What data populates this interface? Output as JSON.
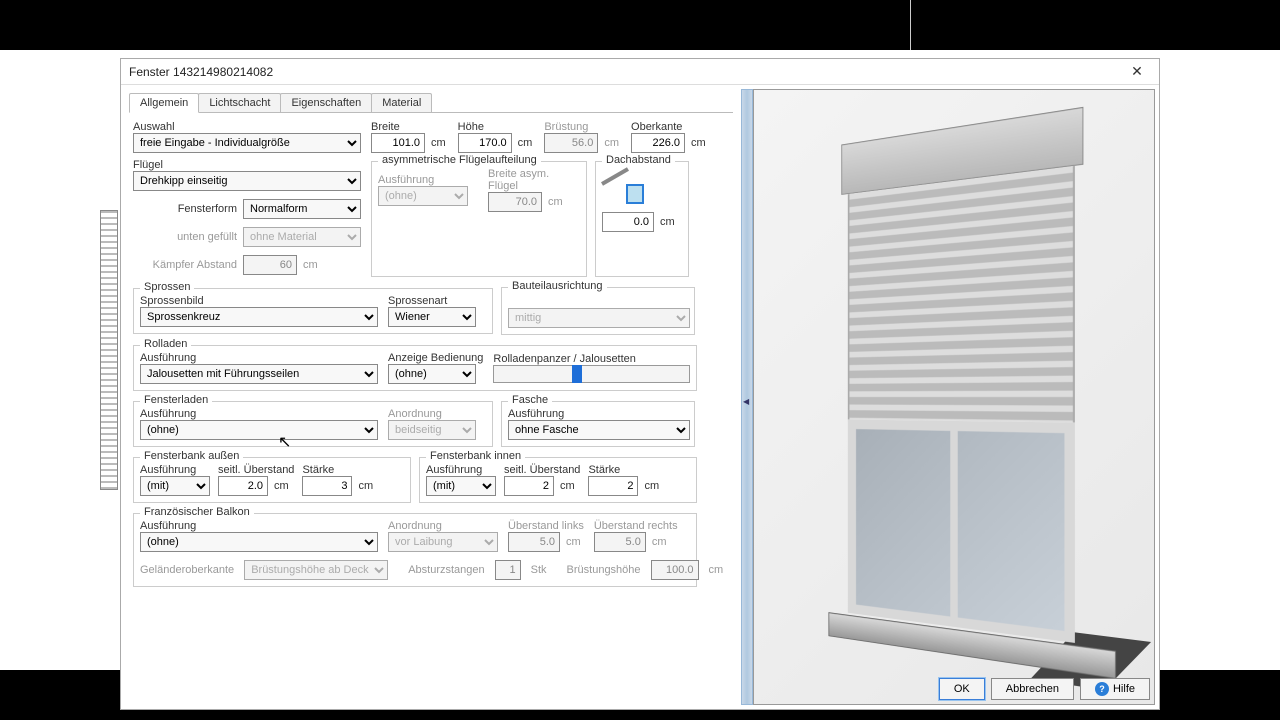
{
  "title": "Fenster 143214980214082",
  "tabs": [
    "Allgemein",
    "Lichtschacht",
    "Eigenschaften",
    "Material"
  ],
  "labels": {
    "auswahl": "Auswahl",
    "fluegel": "Flügel",
    "fensterform": "Fensterform",
    "unten_gefuellt": "unten gefüllt",
    "kaempfer": "Kämpfer Abstand",
    "breite": "Breite",
    "hoehe": "Höhe",
    "bruestung": "Brüstung",
    "oberkante": "Oberkante",
    "dachabstand": "Dachabstand",
    "asym_title": "asymmetrische Flügelaufteilung",
    "asym_ausf": "Ausführung",
    "asym_breite": "Breite asym. Flügel",
    "sprossen": "Sprossen",
    "sprossenbild": "Sprossenbild",
    "sprossenart": "Sprossenart",
    "bauteilausrichtung": "Bauteilausrichtung",
    "rolladen": "Rolladen",
    "ausfuehrung": "Ausführung",
    "anzeige": "Anzeige Bedienung",
    "rollpanzer": "Rolladenpanzer / Jalousetten",
    "fensterladen": "Fensterladen",
    "anordnung": "Anordnung",
    "fasche": "Fasche",
    "fb_aussen": "Fensterbank außen",
    "fb_innen": "Fensterbank innen",
    "seitl": "seitl. Überstand",
    "staerke": "Stärke",
    "franz": "Französischer Balkon",
    "gelaender": "Geländeroberkante",
    "absturz": "Absturzstangen",
    "stk": "Stk",
    "bruesth": "Brüstungshöhe",
    "ueber_links": "Überstand links",
    "ueber_rechts": "Überstand rechts",
    "cm": "cm"
  },
  "values": {
    "auswahl": "freie Eingabe - Individualgröße",
    "fluegel": "Drehkipp einseitig",
    "fensterform": "Normalform",
    "unten_gefuellt": "ohne Material",
    "kaempfer": "60",
    "breite": "101.0",
    "hoehe": "170.0",
    "bruestung": "56.0",
    "oberkante": "226.0",
    "dachabstand": "0.0",
    "asym_ausf": "(ohne)",
    "asym_breite": "70.0",
    "sprossenbild": "Sprossenkreuz",
    "sprossenart": "Wiener",
    "bauteil": "mittig",
    "roll_ausf": "Jalousetten mit Führungsseilen",
    "roll_anzeige": "(ohne)",
    "fladen_ausf": "(ohne)",
    "fladen_anordnung": "beidseitig",
    "fasche_ausf": "ohne Fasche",
    "fb_a_ausf": "(mit)",
    "fb_a_seitl": "2.0",
    "fb_a_staerke": "3",
    "fb_i_ausf": "(mit)",
    "fb_i_seitl": "2",
    "fb_i_staerke": "2",
    "franz_ausf": "(ohne)",
    "franz_anordnung": "vor Laibung",
    "gelaender": "Brüstungshöhe ab Decke",
    "absturz": "1",
    "bruesth": "100.0",
    "ueber_links": "5.0",
    "ueber_rechts": "5.0"
  },
  "buttons": {
    "ok": "OK",
    "cancel": "Abbrechen",
    "help": "Hilfe"
  }
}
